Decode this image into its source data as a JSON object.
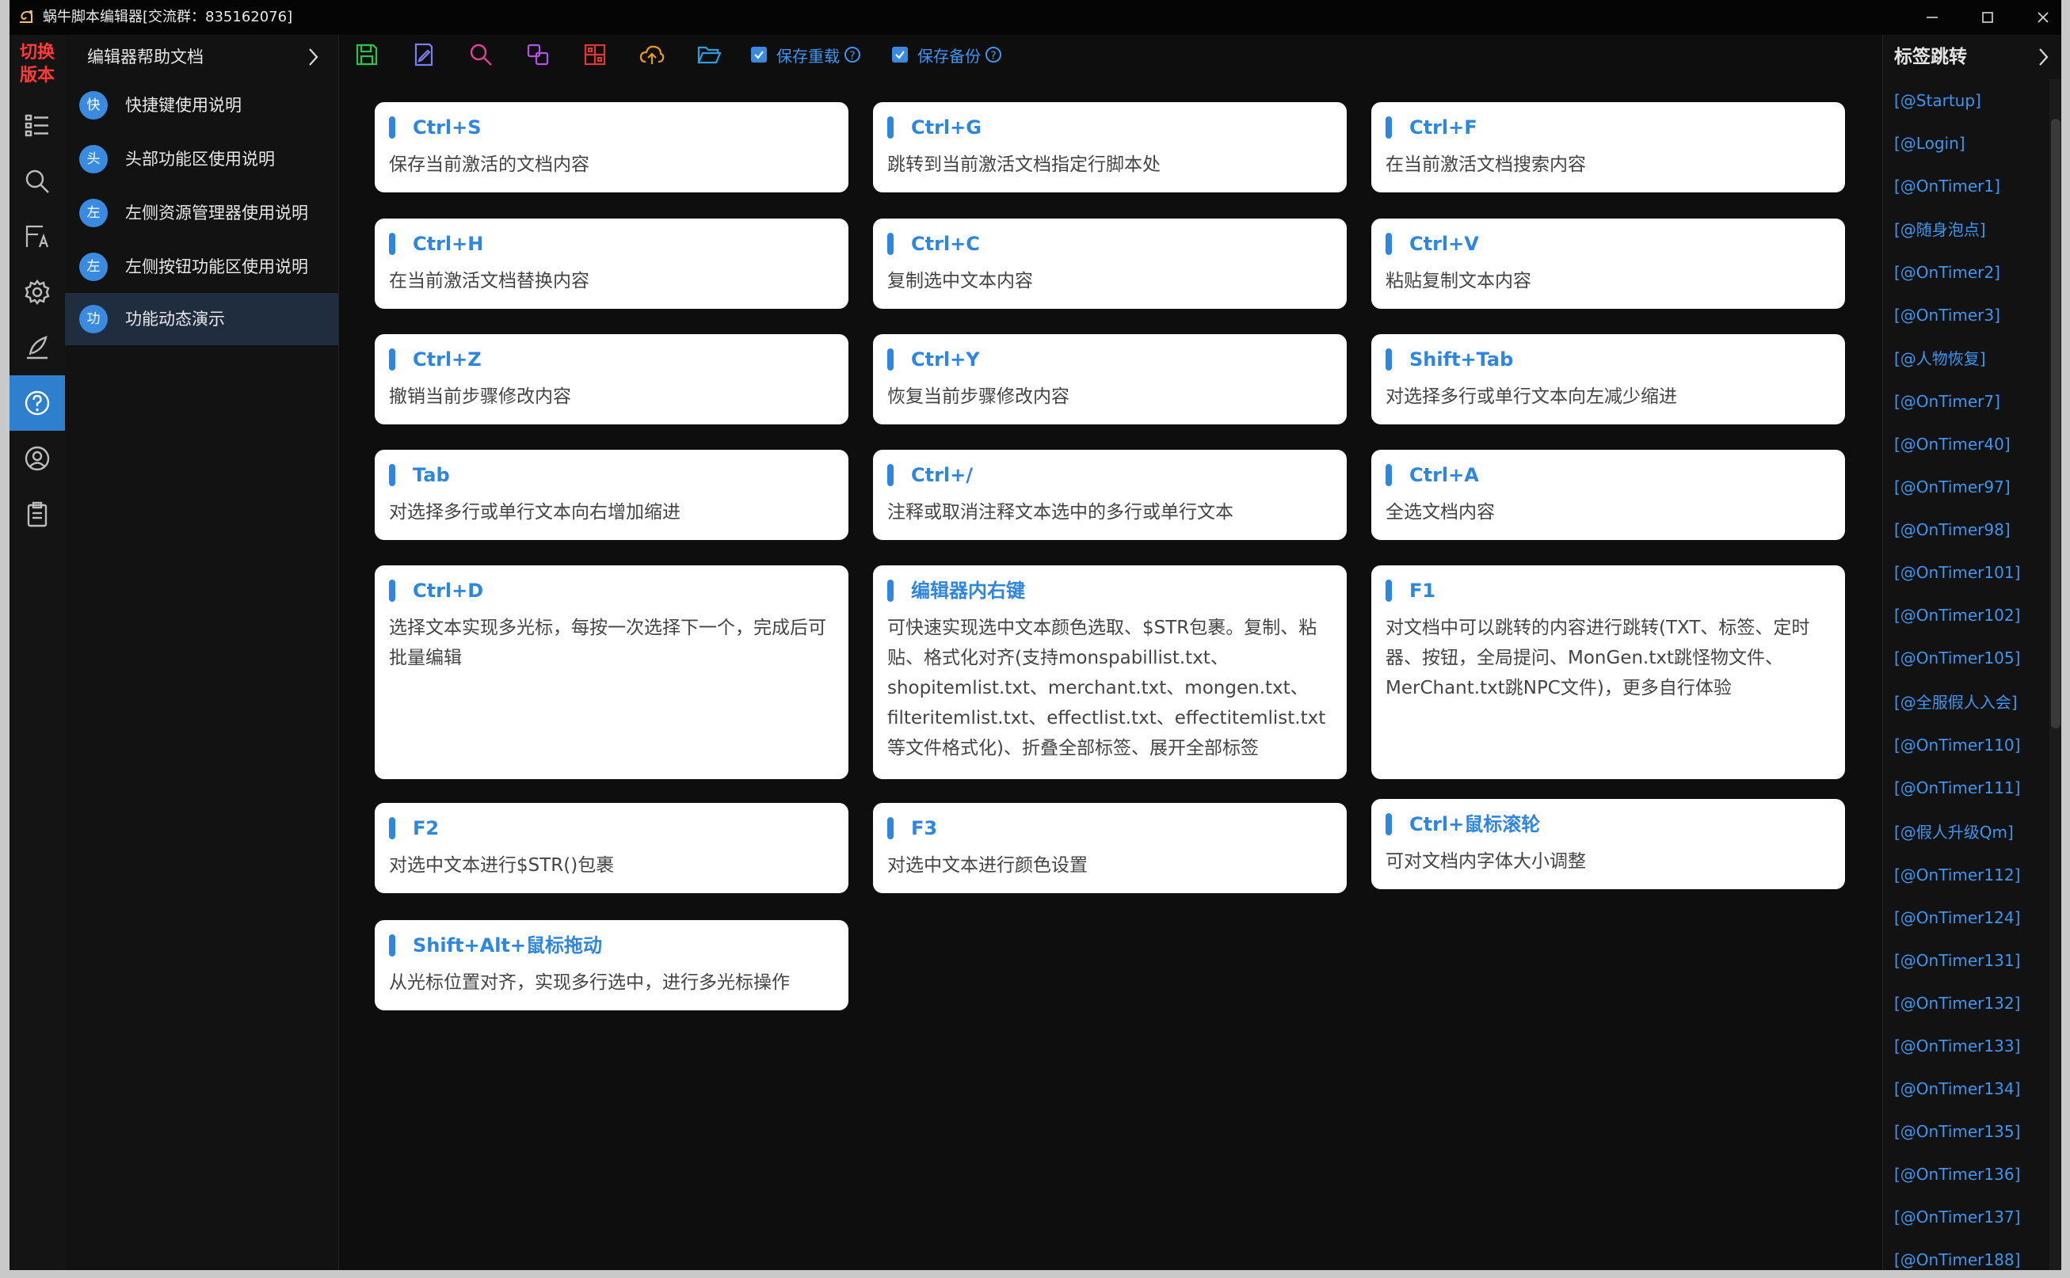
{
  "window": {
    "title": "蜗牛脚本编辑器[交流群：835162076]"
  },
  "activity_bar": {
    "switch_version": "切换版本"
  },
  "help_panel": {
    "header": "编辑器帮助文档",
    "items": [
      {
        "badge": "快",
        "label": "快捷键使用说明"
      },
      {
        "badge": "头",
        "label": "头部功能区使用说明"
      },
      {
        "badge": "左",
        "label": "左侧资源管理器使用说明"
      },
      {
        "badge": "左",
        "label": "左侧按钮功能区使用说明"
      },
      {
        "badge": "功",
        "label": "功能动态演示"
      }
    ]
  },
  "toolbar": {
    "save_reload": "保存重载",
    "save_backup": "保存备份"
  },
  "cards": [
    {
      "key": "Ctrl+S",
      "desc": "保存当前激活的文档内容"
    },
    {
      "key": "Ctrl+G",
      "desc": "跳转到当前激活文档指定行脚本处"
    },
    {
      "key": "Ctrl+F",
      "desc": "在当前激活文档搜索内容"
    },
    {
      "key": "Ctrl+H",
      "desc": "在当前激活文档替换内容"
    },
    {
      "key": "Ctrl+C",
      "desc": "复制选中文本内容"
    },
    {
      "key": "Ctrl+V",
      "desc": "粘贴复制文本内容"
    },
    {
      "key": "Ctrl+Z",
      "desc": "撤销当前步骤修改内容"
    },
    {
      "key": "Ctrl+Y",
      "desc": "恢复当前步骤修改内容"
    },
    {
      "key": "Shift+Tab",
      "desc": "对选择多行或单行文本向左减少缩进"
    },
    {
      "key": "Tab",
      "desc": "对选择多行或单行文本向右增加缩进"
    },
    {
      "key": "Ctrl+/",
      "desc": "注释或取消注释文本选中的多行或单行文本"
    },
    {
      "key": "Ctrl+A",
      "desc": "全选文档内容"
    },
    {
      "key": "Ctrl+D",
      "desc": "选择文本实现多光标，每按一次选择下一个，完成后可批量编辑"
    },
    {
      "key": "编辑器内右键",
      "desc": "可快速实现选中文本颜色选取、$STR包裹。复制、粘贴、格式化对齐(支持monspabillist.txt、shopitemlist.txt、merchant.txt、mongen.txt、filteritemlist.txt、effectlist.txt、effectitemlist.txt等文件格式化)、折叠全部标签、展开全部标签"
    },
    {
      "key": "F1",
      "desc": "对文档中可以跳转的内容进行跳转(TXT、标签、定时器、按钮，全局提问、MonGen.txt跳怪物文件、MerChant.txt跳NPC文件)，更多自行体验"
    },
    {
      "key": "F2",
      "desc": "对选中文本进行$STR()包裹"
    },
    {
      "key": "F3",
      "desc": "对选中文本进行颜色设置"
    },
    {
      "key": "Ctrl+鼠标滚轮",
      "desc": "可对文档内字体大小调整"
    },
    {
      "key": "Shift+Alt+鼠标拖动",
      "desc": "从光标位置对齐，实现多行选中，进行多光标操作"
    }
  ],
  "tag_panel": {
    "header": "标签跳转",
    "tags": [
      "[@Startup]",
      "[@Login]",
      "[@OnTimer1]",
      "[@随身泡点]",
      "[@OnTimer2]",
      "[@OnTimer3]",
      "[@人物恢复]",
      "[@OnTimer7]",
      "[@OnTimer40]",
      "[@OnTimer97]",
      "[@OnTimer98]",
      "[@OnTimer101]",
      "[@OnTimer102]",
      "[@OnTimer105]",
      "[@全服假人入会]",
      "[@OnTimer110]",
      "[@OnTimer111]",
      "[@假人升级Qm]",
      "[@OnTimer112]",
      "[@OnTimer124]",
      "[@OnTimer131]",
      "[@OnTimer132]",
      "[@OnTimer133]",
      "[@OnTimer134]",
      "[@OnTimer135]",
      "[@OnTimer136]",
      "[@OnTimer137]",
      "[@OnTimer188]"
    ]
  },
  "colors": {
    "accent": "#2e86de",
    "switch_version": "#ff3b3b",
    "active_nav": "#2f7fcf"
  }
}
